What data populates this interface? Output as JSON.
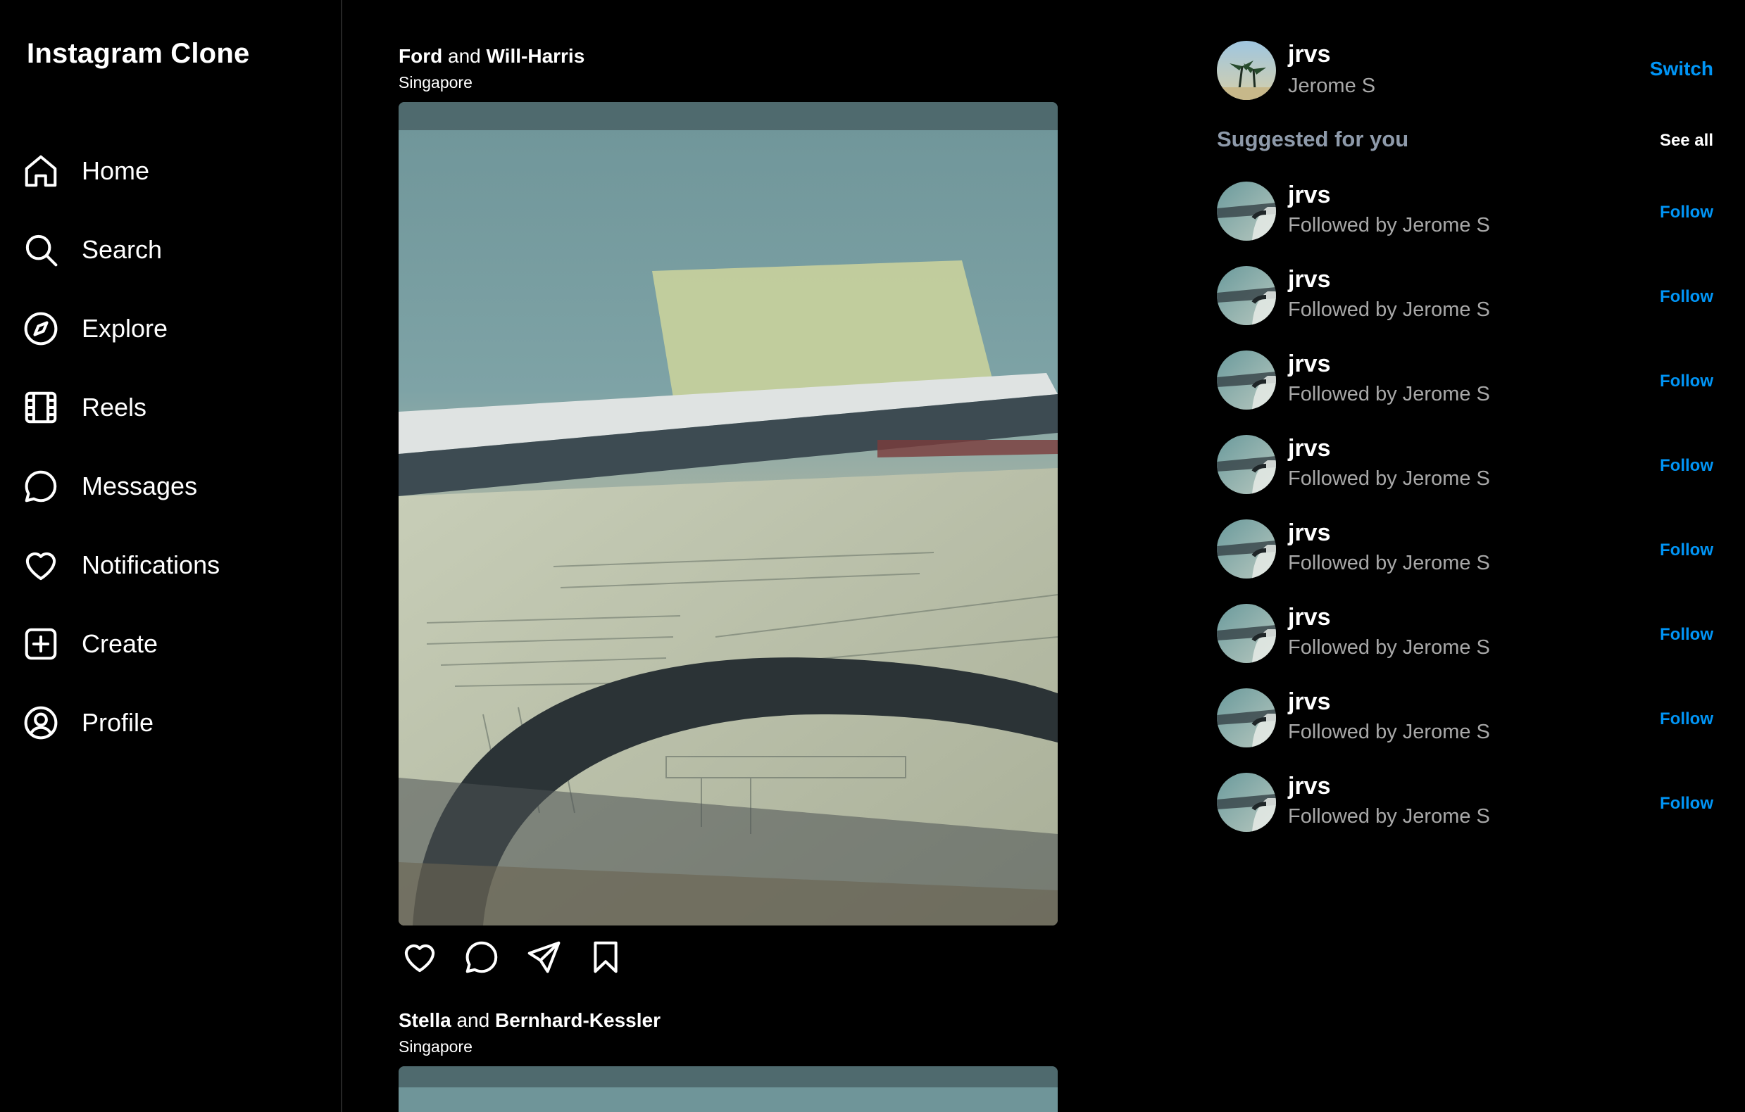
{
  "app": {
    "title": "Instagram Clone"
  },
  "nav": [
    {
      "label": "Home",
      "icon": "home-icon"
    },
    {
      "label": "Search",
      "icon": "search-icon"
    },
    {
      "label": "Explore",
      "icon": "compass-icon"
    },
    {
      "label": "Reels",
      "icon": "film-icon"
    },
    {
      "label": "Messages",
      "icon": "chat-icon"
    },
    {
      "label": "Notifications",
      "icon": "heart-icon"
    },
    {
      "label": "Create",
      "icon": "plus-square-icon"
    },
    {
      "label": "Profile",
      "icon": "user-circle-icon"
    }
  ],
  "feed": {
    "posts": [
      {
        "first": "Ford",
        "and": "and",
        "second": "Will-Harris",
        "location": "Singapore"
      },
      {
        "first": "Stella",
        "and": "and",
        "second": "Bernhard-Kessler",
        "location": "Singapore"
      }
    ],
    "actions": [
      "heart-icon",
      "comment-icon",
      "share-icon",
      "bookmark-icon"
    ]
  },
  "profile": {
    "username": "jrvs",
    "fullname": "Jerome S",
    "switch_label": "Switch"
  },
  "suggestions": {
    "title": "Suggested for you",
    "see_all": "See all",
    "items": [
      {
        "username": "jrvs",
        "subtitle": "Followed by Jerome S",
        "action": "Follow"
      },
      {
        "username": "jrvs",
        "subtitle": "Followed by Jerome S",
        "action": "Follow"
      },
      {
        "username": "jrvs",
        "subtitle": "Followed by Jerome S",
        "action": "Follow"
      },
      {
        "username": "jrvs",
        "subtitle": "Followed by Jerome S",
        "action": "Follow"
      },
      {
        "username": "jrvs",
        "subtitle": "Followed by Jerome S",
        "action": "Follow"
      },
      {
        "username": "jrvs",
        "subtitle": "Followed by Jerome S",
        "action": "Follow"
      },
      {
        "username": "jrvs",
        "subtitle": "Followed by Jerome S",
        "action": "Follow"
      },
      {
        "username": "jrvs",
        "subtitle": "Followed by Jerome S",
        "action": "Follow"
      }
    ]
  },
  "colors": {
    "accent": "#0095f6",
    "background": "#000000",
    "muted": "#a8a8a8",
    "border": "#262626"
  }
}
